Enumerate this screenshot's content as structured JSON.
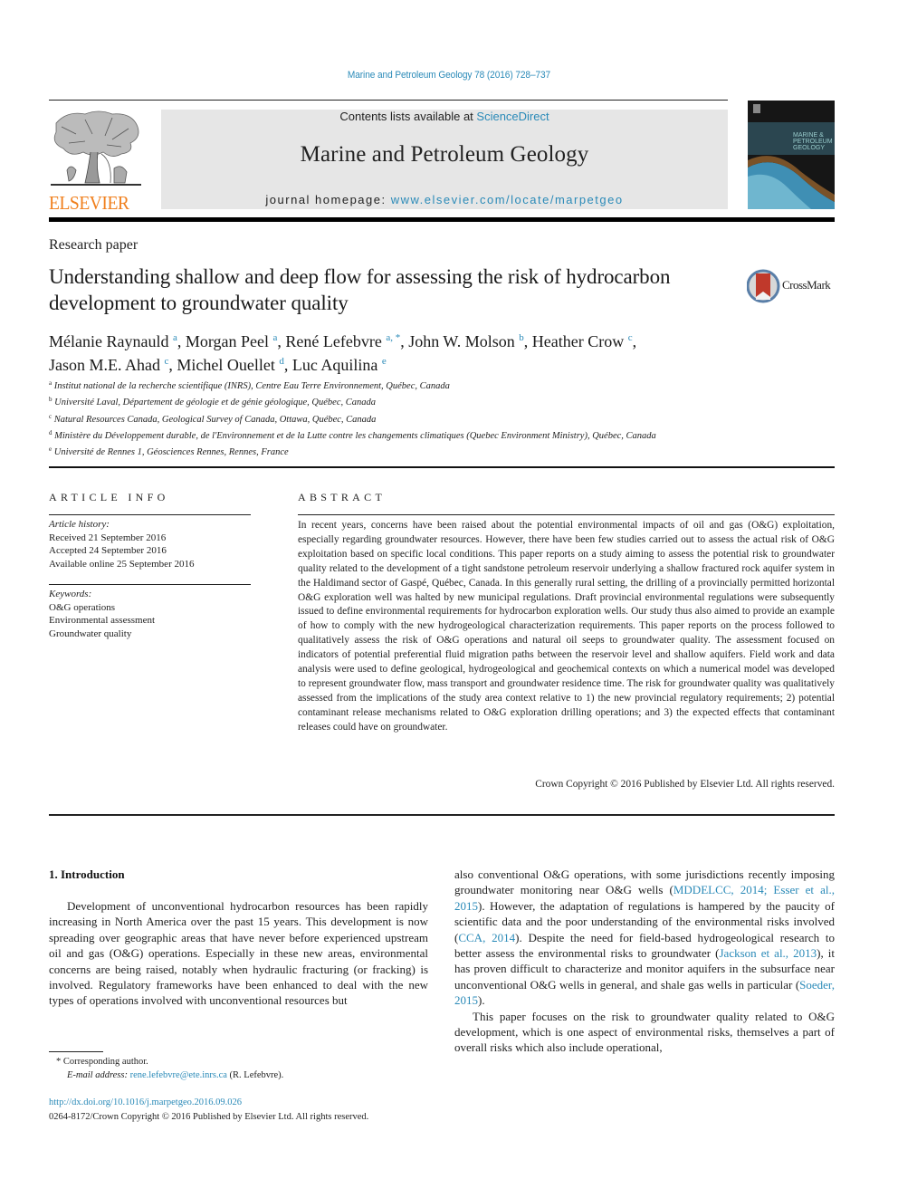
{
  "header": {
    "citation": "Marine and Petroleum Geology 78 (2016) 728–737",
    "publisher_logo_text": "ELSEVIER",
    "contents_prefix": "Contents lists available at ",
    "contents_link": "ScienceDirect",
    "journal_title": "Marine and Petroleum Geology",
    "homepage_prefix": "journal homepage: ",
    "homepage_link": "www.elsevier.com/locate/marpetgeo",
    "crossmark_label": "CrossMark"
  },
  "article": {
    "type": "Research paper",
    "title": "Understanding shallow and deep flow for assessing the risk of hydrocarbon development to groundwater quality",
    "authors": [
      {
        "name": "Mélanie Raynauld",
        "sup": "a",
        "sep": ", "
      },
      {
        "name": "Morgan Peel",
        "sup": "a",
        "sep": ", "
      },
      {
        "name": "René Lefebvre",
        "sup": "a, *",
        "sep": ", "
      },
      {
        "name": "John W. Molson",
        "sup": "b",
        "sep": ", "
      },
      {
        "name": "Heather Crow",
        "sup": "c",
        "sep": ","
      },
      {
        "name": "Jason M.E. Ahad",
        "sup": "c",
        "sep": ", "
      },
      {
        "name": "Michel Ouellet",
        "sup": "d",
        "sep": ", "
      },
      {
        "name": "Luc Aquilina",
        "sup": "e",
        "sep": ""
      }
    ],
    "affiliations": [
      {
        "key": "a",
        "text": "Institut national de la recherche scientifique (INRS), Centre Eau Terre Environnement, Québec, Canada"
      },
      {
        "key": "b",
        "text": "Université Laval, Département de géologie et de génie géologique, Québec, Canada"
      },
      {
        "key": "c",
        "text": "Natural Resources Canada, Geological Survey of Canada, Ottawa, Québec, Canada"
      },
      {
        "key": "d",
        "text": "Ministère du Développement durable, de l'Environnement et de la Lutte contre les changements climatiques (Quebec Environment Ministry), Québec, Canada"
      },
      {
        "key": "e",
        "text": "Université de Rennes 1, Géosciences Rennes, Rennes, France"
      }
    ]
  },
  "article_info": {
    "heading": "ARTICLE INFO",
    "history_label": "Article history:",
    "history": [
      "Received 21 September 2016",
      "Accepted 24 September 2016",
      "Available online 25 September 2016"
    ],
    "keywords_label": "Keywords:",
    "keywords": [
      "O&G operations",
      "Environmental assessment",
      "Groundwater quality"
    ]
  },
  "abstract": {
    "heading": "ABSTRACT",
    "text": "In recent years, concerns have been raised about the potential environmental impacts of oil and gas (O&G) exploitation, especially regarding groundwater resources. However, there have been few studies carried out to assess the actual risk of O&G exploitation based on specific local conditions. This paper reports on a study aiming to assess the potential risk to groundwater quality related to the development of a tight sandstone petroleum reservoir underlying a shallow fractured rock aquifer system in the Haldimand sector of Gaspé, Québec, Canada. In this generally rural setting, the drilling of a provincially permitted horizontal O&G exploration well was halted by new municipal regulations. Draft provincial environmental regulations were subsequently issued to define environmental requirements for hydro­carbon exploration wells. Our study thus also aimed to provide an example of how to comply with the new hydrogeological characterization requirements. This paper reports on the process followed to qualitatively assess the risk of O&G operations and natural oil seeps to groundwater quality. The assessment focused on indicators of potential preferential fluid migration paths between the reservoir level and shallow aquifers. Field work and data analysis were used to define geological, hydrogeological and geochemical contexts on which a numerical model was developed to represent groundwater flow, mass transport and groundwater residence time. The risk for groundwater quality was qualitatively assessed from the implications of the study area context relative to 1) the new provincial regulatory requirements; 2) potential contaminant release mechanisms related to O&G exploration drilling oper­ations; and 3) the expected effects that contaminant releases could have on groundwater.",
    "copyright": "Crown Copyright © 2016 Published by Elsevier Ltd. All rights reserved."
  },
  "body": {
    "section_heading": "1.  Introduction",
    "left_p1": "Development of unconventional hydrocarbon resources has been rapidly increasing in North America over the past 15 years. This development is now spreading over geographic areas that have never before experienced upstream oil and gas (O&G) operations. Especially in these new areas, environmental concerns are being raised, notably when hydraulic fracturing (or fracking) is involved. Regulatory frameworks have been enhanced to deal with the new types of operations involved with unconventional resources but",
    "right_p1": {
      "t1": "also conventional O&G operations, with some jurisdictions recently imposing groundwater monitoring near O&G wells (",
      "ref1": "MDDELCC, 2014; Esser et al., 2015",
      "t2": "). However, the adaptation of regulations is hampered by the paucity of scientific data and the poor under­standing of the environmental risks involved (",
      "ref2": "CCA, 2014",
      "t3": "). Despite the need for field-based hydrogeological research to better assess the environmental risks to groundwater (",
      "ref3": "Jackson et al., 2013",
      "t4": "), it has proven difficult to characterize and monitor aquifers in the sub­surface near unconventional O&G wells in general, and shale gas wells in particular (",
      "ref4": "Soeder, 2015",
      "t5": ")."
    },
    "right_p2": "This paper focuses on the risk to groundwater quality related to O&G development, which is one aspect of environmental risks, themselves a part of overall risks which also include operational,"
  },
  "footnotes": {
    "corresponding": "* Corresponding author.",
    "email_label": "E-mail address: ",
    "email": "rene.lefebvre@ete.inrs.ca",
    "email_suffix": " (R. Lefebvre).",
    "doi": "http://dx.doi.org/10.1016/j.marpetgeo.2016.09.026",
    "issn_line": "0264-8172/Crown Copyright © 2016 Published by Elsevier Ltd. All rights reserved."
  }
}
